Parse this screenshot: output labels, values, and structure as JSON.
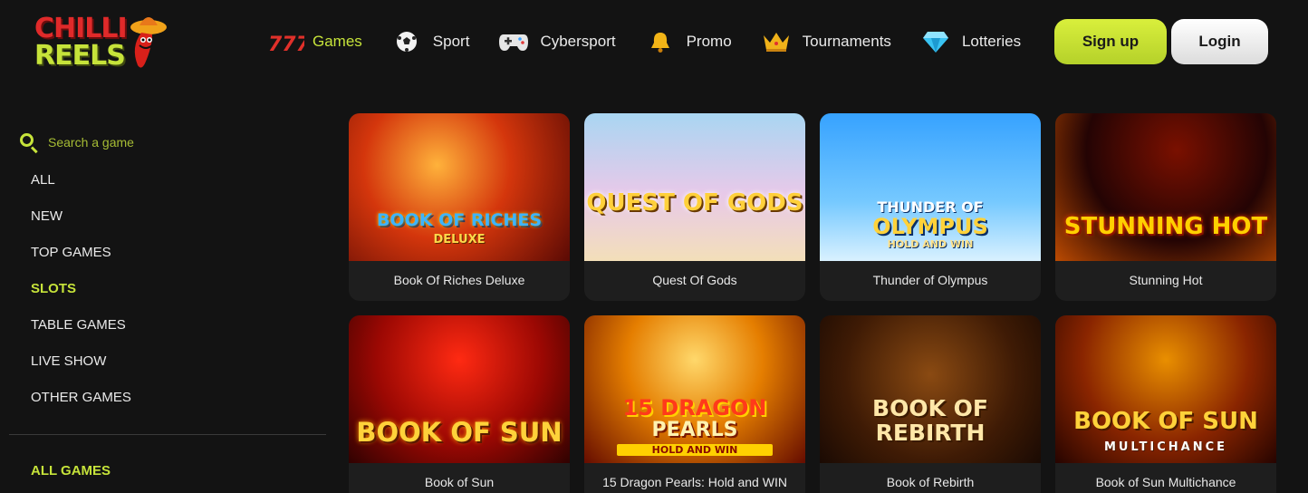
{
  "brand": {
    "line1": "CHILLI",
    "line2": "REELS"
  },
  "nav": [
    {
      "label": "Games",
      "icon": "sevens-icon",
      "active": true
    },
    {
      "label": "Sport",
      "icon": "soccer-ball-icon",
      "active": false
    },
    {
      "label": "Cybersport",
      "icon": "gamepad-icon",
      "active": false
    },
    {
      "label": "Promo",
      "icon": "bell-icon",
      "active": false
    },
    {
      "label": "Tournaments",
      "icon": "crown-icon",
      "active": false
    },
    {
      "label": "Lotteries",
      "icon": "diamond-icon",
      "active": false
    }
  ],
  "auth": {
    "signup": "Sign up",
    "login": "Login"
  },
  "search": {
    "placeholder": "Search a game"
  },
  "categories": [
    {
      "label": "ALL",
      "active": false
    },
    {
      "label": "NEW",
      "active": false
    },
    {
      "label": "TOP GAMES",
      "active": false
    },
    {
      "label": "SLOTS",
      "active": true
    },
    {
      "label": "TABLE GAMES",
      "active": false
    },
    {
      "label": "LIVE SHOW",
      "active": false
    },
    {
      "label": "OTHER GAMES",
      "active": false
    }
  ],
  "section": {
    "all_games": "ALL GAMES"
  },
  "games": [
    {
      "name": "Book Of Riches Deluxe",
      "art": [
        "BOOK OF RICHES",
        "DELUXE"
      ]
    },
    {
      "name": "Quest Of Gods",
      "art": [
        "QUEST OF GODS"
      ]
    },
    {
      "name": "Thunder of Olympus",
      "art": [
        "THUNDER OF",
        "OLYMPUS",
        "HOLD AND WIN"
      ]
    },
    {
      "name": "Stunning Hot",
      "art": [
        "STUNNING HOT"
      ]
    },
    {
      "name": "Book of Sun",
      "art": [
        "BOOK OF SUN"
      ]
    },
    {
      "name": "15 Dragon Pearls: Hold and WIN",
      "art": [
        "15 DRAGON",
        "PEARLS",
        "HOLD AND WIN"
      ]
    },
    {
      "name": "Book of Rebirth",
      "art": [
        "BOOK OF",
        "REBIRTH"
      ]
    },
    {
      "name": "Book of Sun Multichance",
      "art": [
        "BOOK OF SUN",
        "MULTICHANCE"
      ]
    }
  ],
  "colors": {
    "accent": "#c6e33a",
    "background": "#131313",
    "card": "#1e1e1e"
  }
}
